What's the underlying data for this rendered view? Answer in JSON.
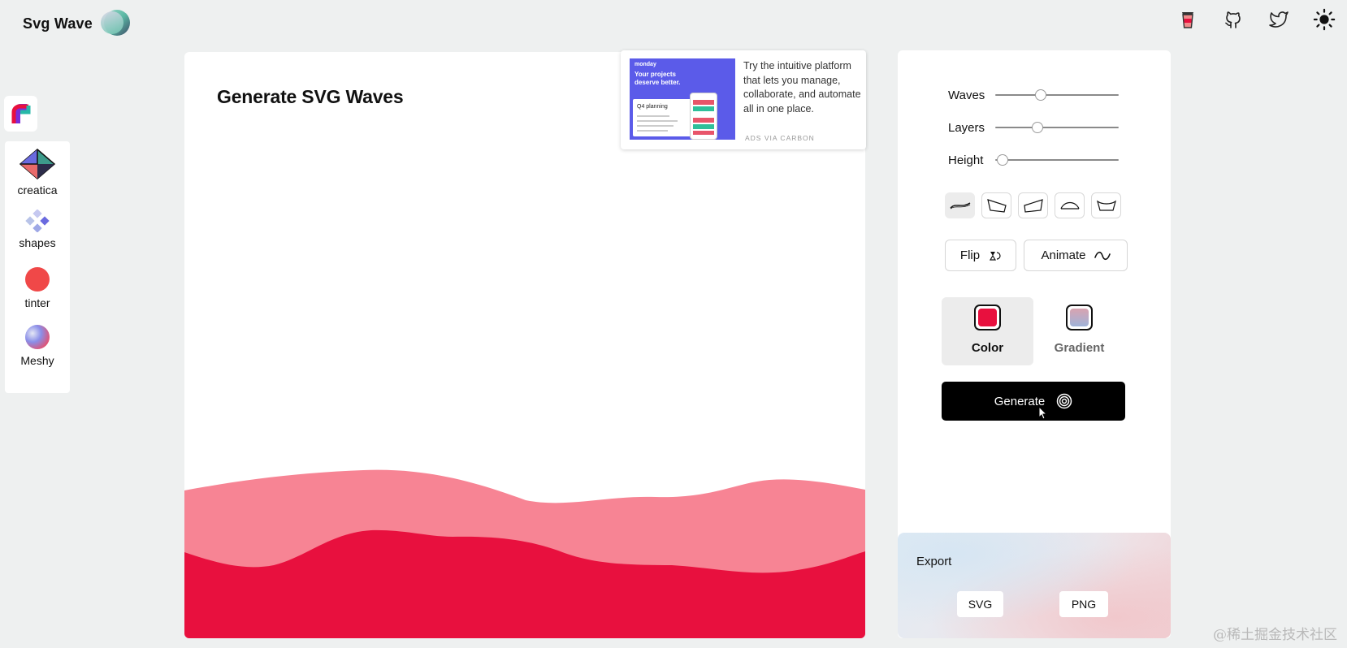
{
  "header": {
    "app_title": "Svg Wave",
    "icons": [
      "coffee-cup-icon",
      "github-icon",
      "twitter-icon",
      "sun-icon"
    ]
  },
  "sidebar": {
    "apps": [
      {
        "label": "creatica",
        "icon": "creatica-cube-icon"
      },
      {
        "label": "shapes",
        "icon": "shapes-diamond-icon"
      },
      {
        "label": "tinter",
        "icon": "tinter-circle-icon"
      },
      {
        "label": "Meshy",
        "icon": "meshy-gradient-icon"
      }
    ]
  },
  "main": {
    "title": "Generate SVG Waves",
    "wave_colors": {
      "back": "#F78494",
      "front": "#E8103E"
    }
  },
  "ad": {
    "brand": "monday",
    "headline": "Your projects deserve better.",
    "card_title": "Q4 planning",
    "text": "Try the intuitive platform that lets you manage, collaborate, and automate all in one place.",
    "via": "ADS VIA CARBON"
  },
  "controls": {
    "sliders": [
      {
        "label": "Waves",
        "value": 0.37
      },
      {
        "label": "Layers",
        "value": 0.34
      },
      {
        "label": "Height",
        "value": 0.06
      }
    ],
    "shapes": [
      "wave-shape-smooth-icon",
      "wave-shape-slope-down-icon",
      "wave-shape-slope-up-icon",
      "wave-shape-peak-icon",
      "wave-shape-valley-icon"
    ],
    "flip_label": "Flip",
    "animate_label": "Animate",
    "modes": [
      {
        "label": "Color",
        "swatch": "#E8103E",
        "active": true
      },
      {
        "label": "Gradient",
        "swatch": "linear-gradient(180deg,#d9a3b0,#9fb3d9)",
        "active": false
      }
    ],
    "generate_label": "Generate"
  },
  "export": {
    "title": "Export",
    "svg_label": "SVG",
    "png_label": "PNG"
  },
  "watermark": "@稀土掘金技术社区",
  "accent": "#E8103E"
}
